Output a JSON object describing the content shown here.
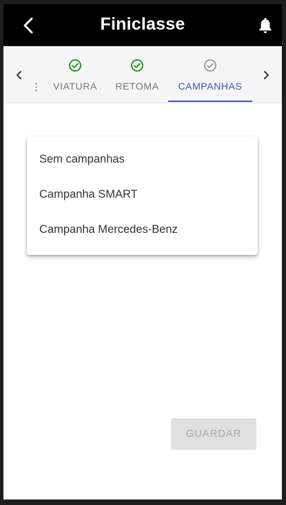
{
  "app": {
    "title": "Finiclasse"
  },
  "tabs": {
    "overflow_glyph": "⋮",
    "items": [
      {
        "label": "VIATURA",
        "status": "complete",
        "icon": "check-circle-icon",
        "color": "#1a8a1a"
      },
      {
        "label": "RETOMA",
        "status": "complete",
        "icon": "check-circle-icon",
        "color": "#1a8a1a"
      },
      {
        "label": "CAMPANHAS",
        "status": "active",
        "icon": "check-circle-icon",
        "color": "#8a8a8a"
      }
    ],
    "accent": "#3f51b5"
  },
  "dropdown": {
    "options": [
      "Sem campanhas",
      "Campanha SMART",
      "Campanha Mercedes-Benz"
    ]
  },
  "actions": {
    "save_label": "GUARDAR",
    "save_enabled": false
  }
}
